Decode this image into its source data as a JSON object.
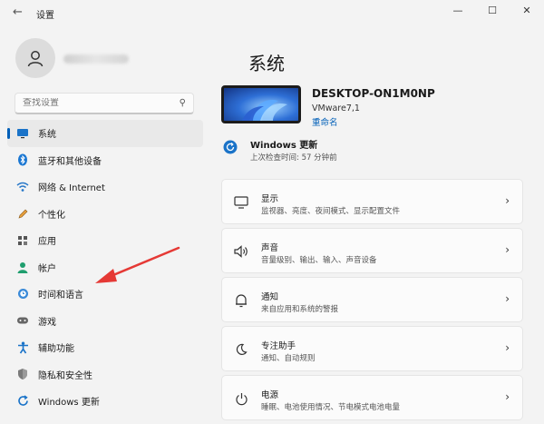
{
  "window": {
    "title": "设置",
    "back": "←",
    "minimize": "—",
    "maximize": "☐",
    "close": "✕"
  },
  "search": {
    "placeholder": "查找设置"
  },
  "sidebar": {
    "items": [
      {
        "label": "系统",
        "icon": "monitor-icon"
      },
      {
        "label": "蓝牙和其他设备",
        "icon": "bluetooth-icon"
      },
      {
        "label": "网络 & Internet",
        "icon": "wifi-icon"
      },
      {
        "label": "个性化",
        "icon": "pen-icon"
      },
      {
        "label": "应用",
        "icon": "apps-icon"
      },
      {
        "label": "帐户",
        "icon": "account-icon"
      },
      {
        "label": "时间和语言",
        "icon": "globe-clock-icon"
      },
      {
        "label": "游戏",
        "icon": "gamepad-icon"
      },
      {
        "label": "辅助功能",
        "icon": "accessibility-icon"
      },
      {
        "label": "隐私和安全性",
        "icon": "shield-icon"
      },
      {
        "label": "Windows 更新",
        "icon": "update-icon"
      }
    ]
  },
  "main": {
    "title": "系统",
    "device": {
      "name": "DESKTOP-ON1M0NP",
      "model": "VMware7,1",
      "rename": "重命名"
    },
    "update": {
      "title": "Windows 更新",
      "subtitle": "上次检查时间: 57 分钟前"
    },
    "cards": [
      {
        "title": "显示",
        "subtitle": "监视器、亮度、夜间模式、显示配置文件",
        "icon": "display-icon"
      },
      {
        "title": "声音",
        "subtitle": "音量级别、输出、输入、声音设备",
        "icon": "speaker-icon"
      },
      {
        "title": "通知",
        "subtitle": "来自应用和系统的警报",
        "icon": "bell-icon"
      },
      {
        "title": "专注助手",
        "subtitle": "通知、自动规则",
        "icon": "moon-icon"
      },
      {
        "title": "电源",
        "subtitle": "睡眠、电池使用情况、节电模式电池电量",
        "icon": "power-icon"
      }
    ],
    "chevron": "›"
  },
  "colors": {
    "accent": "#005fb8",
    "arrow": "#e53935"
  }
}
